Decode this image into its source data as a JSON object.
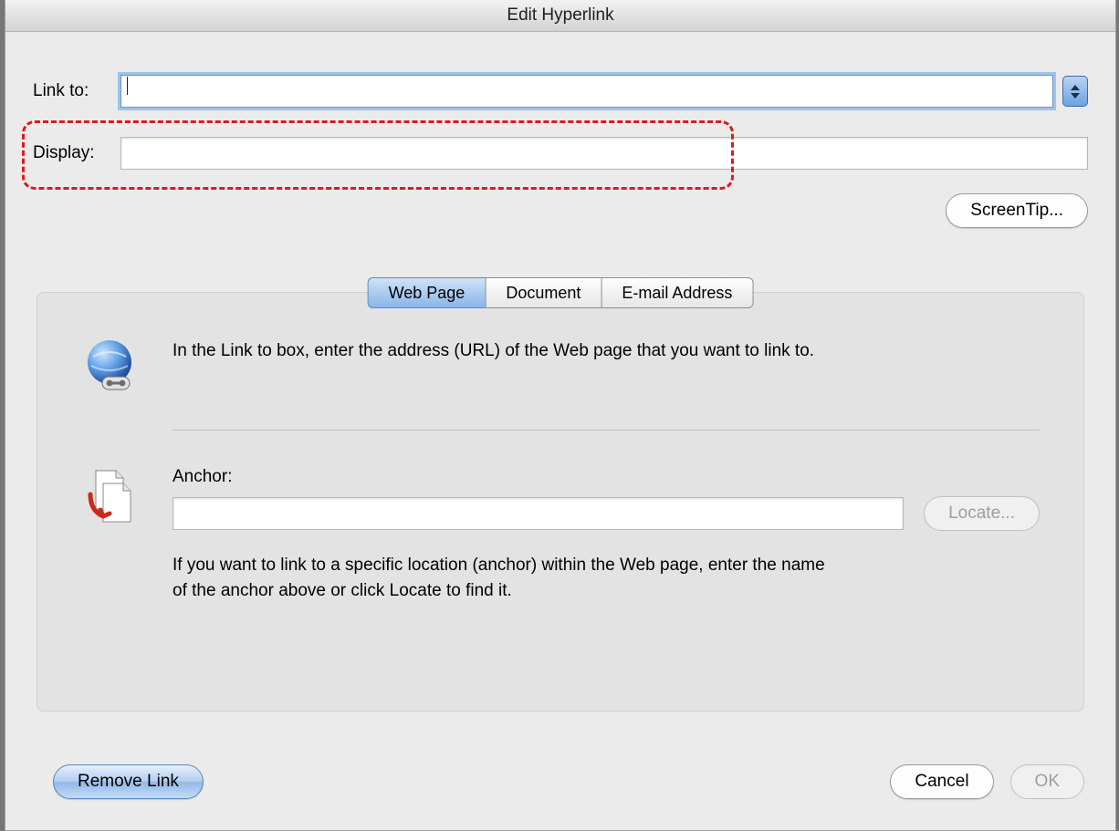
{
  "dialog": {
    "title": "Edit Hyperlink",
    "link_to_label": "Link to:",
    "link_to_value": "",
    "display_label": "Display:",
    "display_value": "",
    "screentip_button": "ScreenTip..."
  },
  "tabs": {
    "web_page": "Web Page",
    "document": "Document",
    "email": "E-mail Address",
    "active": "web_page"
  },
  "webpage_pane": {
    "help1": "In the Link to box, enter the address (URL) of the Web page that you want to link to.",
    "anchor_label": "Anchor:",
    "anchor_value": "",
    "locate_button": "Locate...",
    "help2": "If you want to link to a specific location (anchor) within the Web page, enter the name of the anchor above or click Locate to find it."
  },
  "footer": {
    "remove_link": "Remove Link",
    "cancel": "Cancel",
    "ok": "OK",
    "ok_enabled": false
  },
  "icons": {
    "combo_stepper": "combo-stepper-icon",
    "globe": "globe-link-icon",
    "anchor_pages": "anchor-pages-icon"
  }
}
